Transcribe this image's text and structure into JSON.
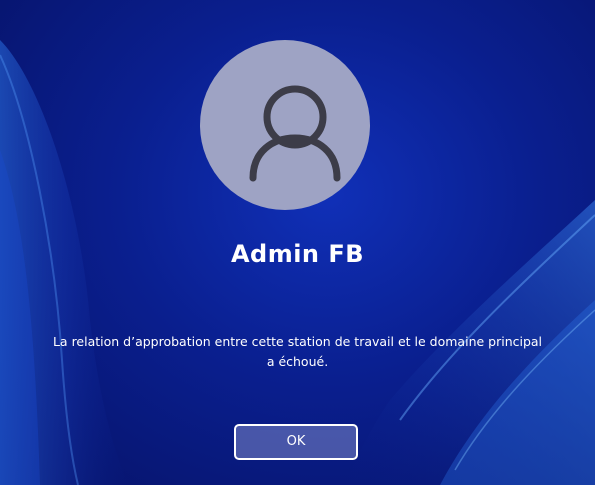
{
  "user": {
    "display_name": "Admin FB",
    "avatar_icon": "user-silhouette-icon"
  },
  "message": {
    "line1": "La relation d’approbation entre cette station de travail et le domaine principal",
    "line2": "a échoué."
  },
  "ok_button": {
    "label": "OK"
  },
  "colors": {
    "background": "#0a1f8f",
    "avatar_circle": "#9ea3c4",
    "avatar_glyph": "#3c3c48",
    "text": "#ffffff",
    "button_fill": "#5863b0"
  }
}
